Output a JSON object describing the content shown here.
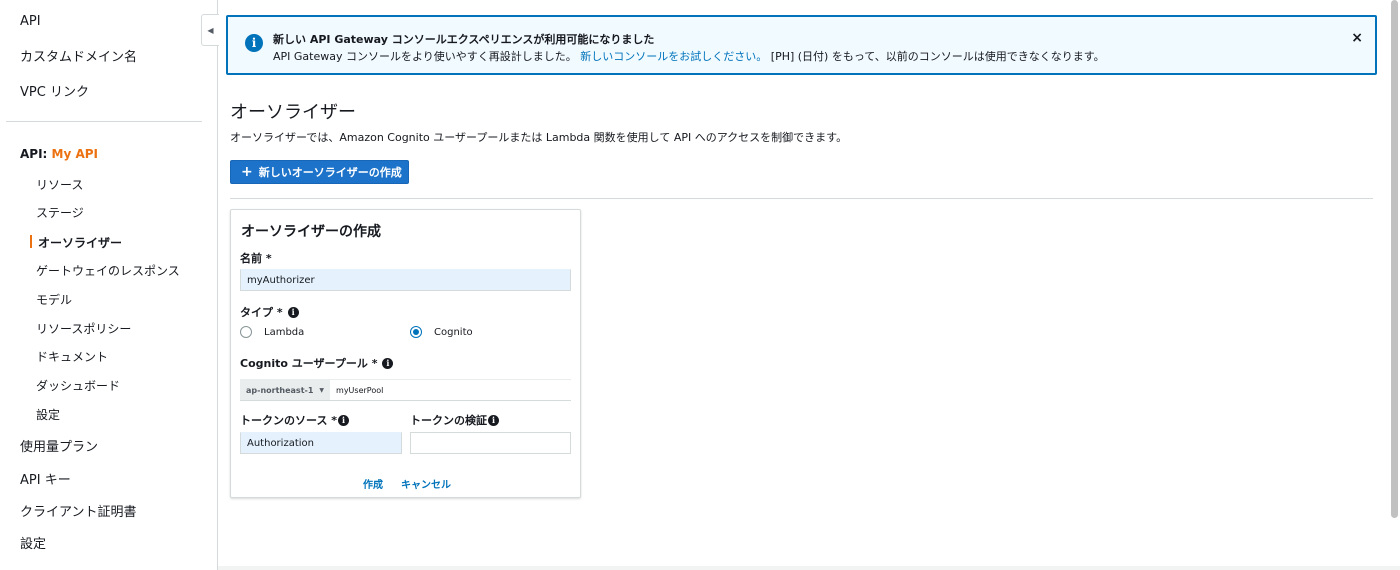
{
  "sidebar": {
    "top_items": [
      "API",
      "カスタムドメイン名",
      "VPC リンク"
    ],
    "api_prefix": "API: ",
    "api_name": "My API",
    "sub_items": [
      "リソース",
      "ステージ",
      "オーソライザー",
      "ゲートウェイのレスポンス",
      "モデル",
      "リソースポリシー",
      "ドキュメント",
      "ダッシュボード",
      "設定"
    ],
    "active_sub": "オーソライザー",
    "bottom_items": [
      "使用量プラン",
      "API キー",
      "クライアント証明書",
      "設定"
    ]
  },
  "banner": {
    "title": "新しい API Gateway コンソールエクスペリエンスが利用可能になりました",
    "body_pre": "API Gateway コンソールをより使いやすく再設計しました。",
    "body_link": "新しいコンソールをお試しください。",
    "body_post": "[PH] (日付) をもって、以前のコンソールは使用できなくなります。",
    "close_glyph": "×",
    "info_glyph": "i"
  },
  "page": {
    "title": "オーソライザー",
    "description": "オーソライザーでは、Amazon Cognito ユーザープールまたは Lambda 関数を使用して API へのアクセスを制御できます。",
    "create_button": "新しいオーソライザーの作成",
    "plus_glyph": "+"
  },
  "form": {
    "title": "オーソライザーの作成",
    "name_label": "名前 *",
    "name_value": "myAuthorizer",
    "type_label": "タイプ *",
    "type_options": [
      "Lambda",
      "Cognito"
    ],
    "type_selected": "Cognito",
    "pool_label": "Cognito ユーザープール *",
    "region": "ap-northeast-1",
    "pool_value": "myUserPool",
    "token_source_label": "トークンのソース *",
    "token_source_value": "Authorization",
    "token_validation_label": "トークンの検証",
    "token_validation_value": "",
    "create_label": "作成",
    "cancel_label": "キャンセル"
  },
  "colors": {
    "accent": "#ec7211",
    "primary": "#1d73c9",
    "link": "#0073bb",
    "banner_bg": "#f1faff"
  }
}
